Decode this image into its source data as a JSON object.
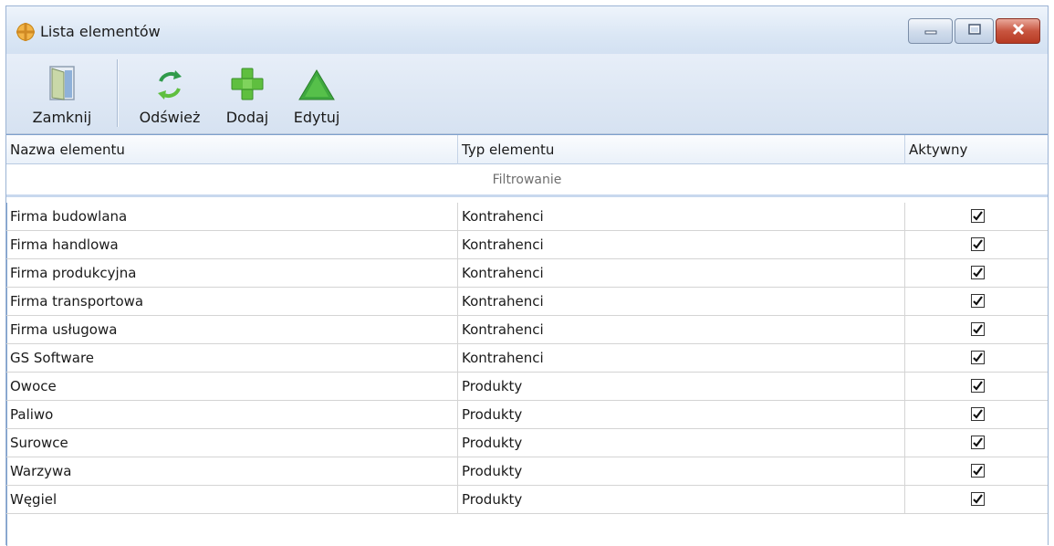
{
  "window": {
    "title": "Lista elementów",
    "controls": {
      "minimize": "minimize-icon",
      "maximize": "maximize-icon",
      "close": "close-icon"
    }
  },
  "toolbar": {
    "close_label": "Zamknij",
    "refresh_label": "Odśwież",
    "add_label": "Dodaj",
    "edit_label": "Edytuj"
  },
  "grid": {
    "columns": [
      "Nazwa elementu",
      "Typ elementu",
      "Aktywny"
    ],
    "filter_label": "Filtrowanie",
    "rows": [
      {
        "name": "Firma budowlana",
        "type": "Kontrahenci",
        "active": true
      },
      {
        "name": "Firma handlowa",
        "type": "Kontrahenci",
        "active": true
      },
      {
        "name": "Firma produkcyjna",
        "type": "Kontrahenci",
        "active": true
      },
      {
        "name": "Firma transportowa",
        "type": "Kontrahenci",
        "active": true
      },
      {
        "name": "Firma usługowa",
        "type": "Kontrahenci",
        "active": true
      },
      {
        "name": "GS Software",
        "type": "Kontrahenci",
        "active": true
      },
      {
        "name": "Owoce",
        "type": "Produkty",
        "active": true
      },
      {
        "name": "Paliwo",
        "type": "Produkty",
        "active": true
      },
      {
        "name": "Surowce",
        "type": "Produkty",
        "active": true
      },
      {
        "name": "Warzywa",
        "type": "Produkty",
        "active": true
      },
      {
        "name": "Węgiel",
        "type": "Produkty",
        "active": true
      }
    ]
  },
  "colors": {
    "accent": "#7ea0cc",
    "toolbar_bg": "#dbe6f4",
    "add_icon": "#5fbf3f",
    "edit_icon": "#3fa83f",
    "close_button": "#c8553f"
  }
}
